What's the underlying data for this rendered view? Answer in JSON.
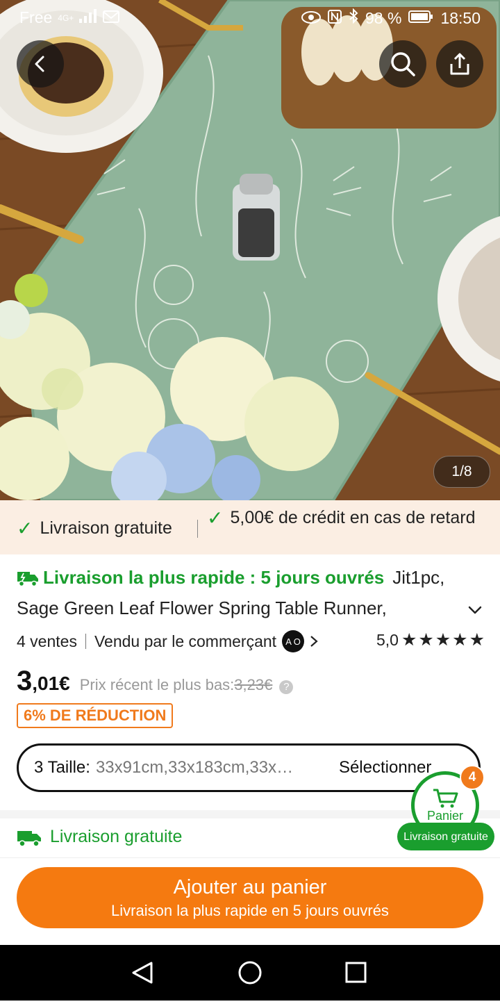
{
  "status_bar": {
    "carrier": "Free",
    "network": "4G+",
    "battery": "98 %",
    "time": "18:50"
  },
  "gallery": {
    "pager": "1/8"
  },
  "banner": {
    "free_delivery": "Livraison gratuite",
    "credit": "5,00€ de crédit en cas de retard"
  },
  "product": {
    "fast_delivery": "Livraison la plus rapide : 5 jours ouvrés",
    "title_part1": "Jit1pc,",
    "title_part2": "Sage Green Leaf Flower Spring Table Runner,",
    "sales": "4 ventes",
    "seller": "Vendu par le commerçant",
    "seller_badge": "A O",
    "rating": "5,0",
    "stars": "★★★★★",
    "price_int": "3",
    "price_dec": ",01€",
    "recent_lowest_label": "Prix récent le plus bas:",
    "recent_lowest_value": "3,23€",
    "discount": "6% DE RÉDUCTION"
  },
  "size_selector": {
    "label": "3 Taille:",
    "value": "33x91cm,33x183cm,33x…",
    "action": "Sélectionner"
  },
  "shipping": {
    "free": "Livraison gratuite"
  },
  "cart": {
    "label": "Panier",
    "count": "4",
    "pill": "Livraison gratuite"
  },
  "add_to_cart": {
    "label": "Ajouter au panier",
    "sub": "Livraison la plus rapide en 5 jours ouvrés"
  },
  "colors": {
    "accent_orange": "#f57a10",
    "green": "#1a9e2e",
    "banner_bg": "#fbeee3"
  }
}
